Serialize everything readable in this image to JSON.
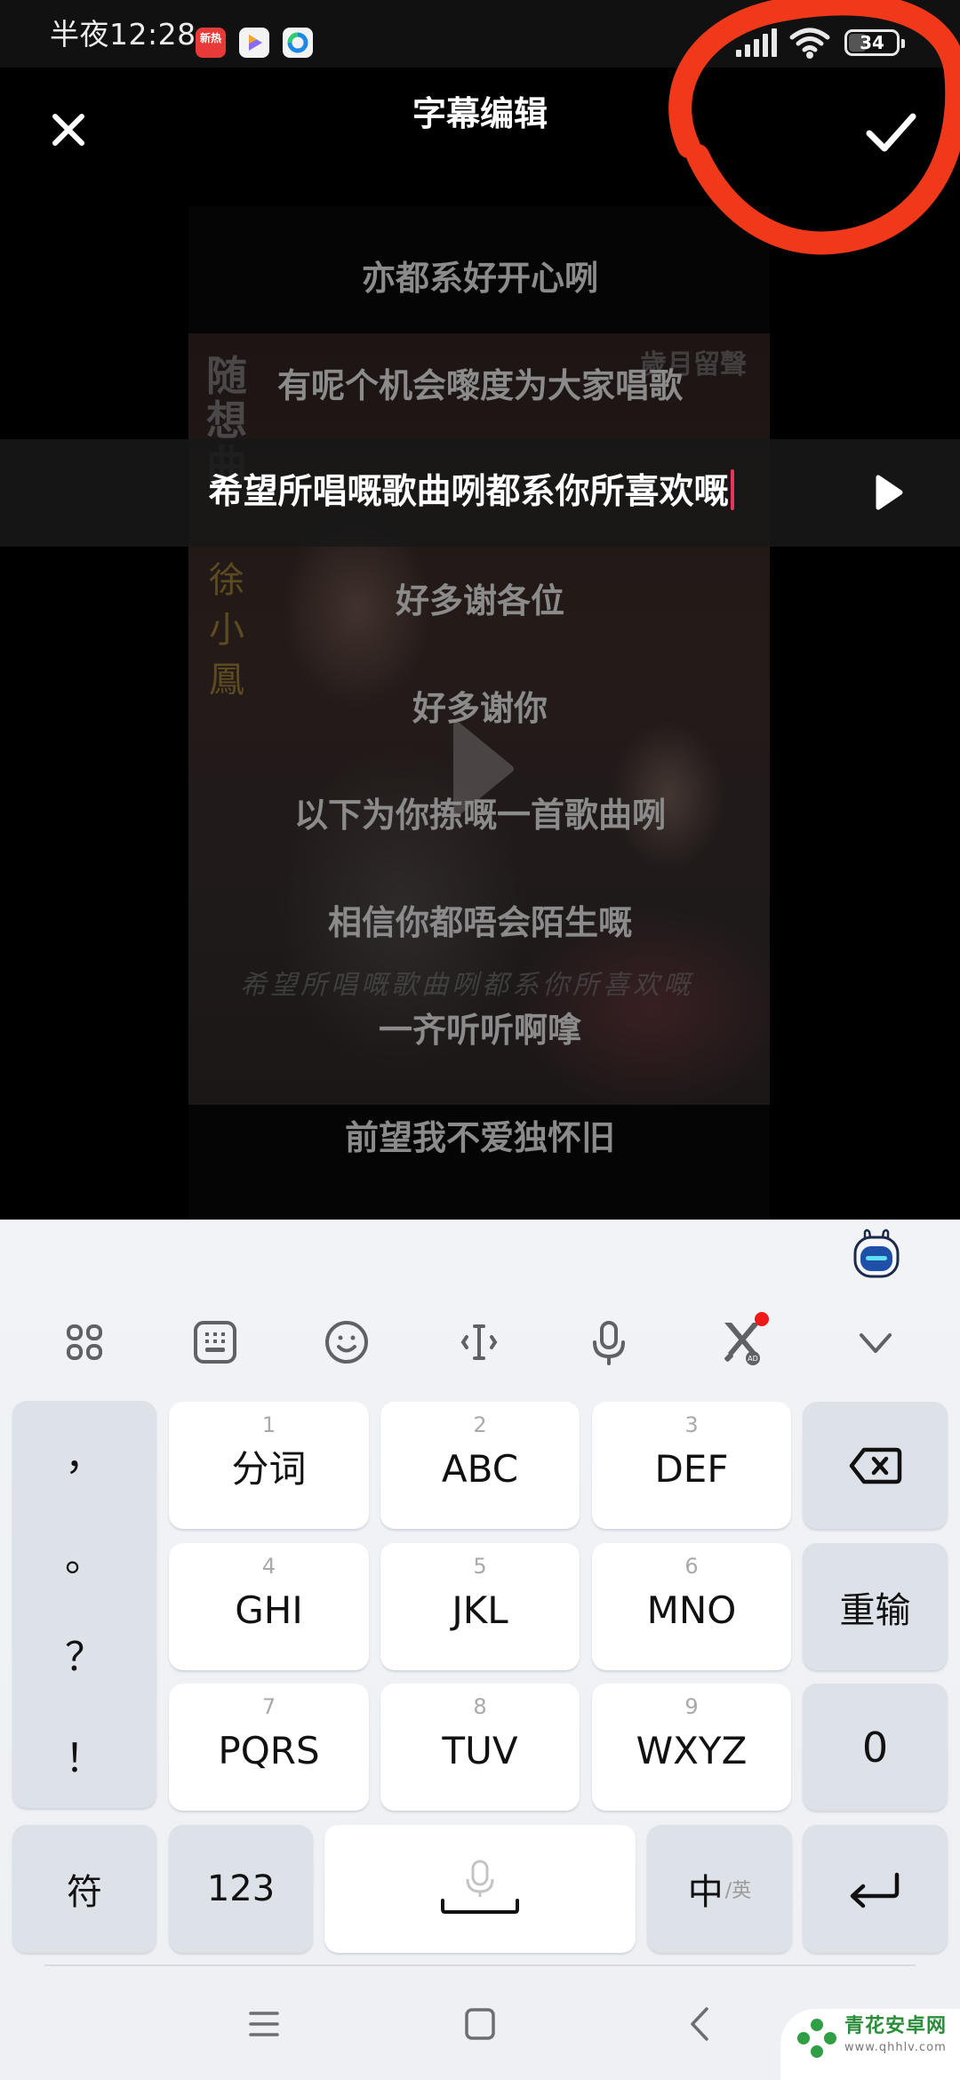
{
  "status_bar": {
    "time": "半夜12:28",
    "notification_apps": [
      {
        "name": "news-app",
        "label": "新热"
      },
      {
        "name": "video-app",
        "label": ""
      },
      {
        "name": "sync-app",
        "label": ""
      }
    ],
    "battery_level": "34"
  },
  "header": {
    "title": "字幕编辑",
    "close_icon": "close-icon",
    "confirm_icon": "check-icon"
  },
  "video": {
    "overlay_title": "随想曲",
    "overlay_artist": "徐小鳳",
    "overlay_brand": "歲月留聲",
    "overlay_script": "希望所唱嘅歌曲咧都系你所喜欢嘅"
  },
  "subtitles": [
    {
      "text": "亦都系好开心咧",
      "selected": false
    },
    {
      "text": "有呢个机会嚟度为大家唱歌",
      "selected": false
    },
    {
      "text": "希望所唱嘅歌曲咧都系你所喜欢嘅",
      "selected": true
    },
    {
      "text": "好多谢各位",
      "selected": false
    },
    {
      "text": "好多谢你",
      "selected": false
    },
    {
      "text": "以下为你拣嘅一首歌曲咧",
      "selected": false
    },
    {
      "text": "相信你都唔会陌生嘅",
      "selected": false
    },
    {
      "text": "一齐听听啊嗱",
      "selected": false
    },
    {
      "text": "前望我不爱独怀旧",
      "selected": false
    }
  ],
  "keyboard": {
    "toolbar": [
      "apps-grid-icon",
      "keyboard-icon",
      "emoji-icon",
      "cursor-move-icon",
      "microphone-icon",
      "game-ad-icon",
      "collapse-keyboard-icon"
    ],
    "punctuation": [
      "，",
      "。",
      "？",
      "！"
    ],
    "keys": [
      {
        "num": "1",
        "label": "分词"
      },
      {
        "num": "2",
        "label": "ABC"
      },
      {
        "num": "3",
        "label": "DEF"
      },
      {
        "num": "4",
        "label": "GHI"
      },
      {
        "num": "5",
        "label": "JKL"
      },
      {
        "num": "6",
        "label": "MNO"
      },
      {
        "num": "7",
        "label": "PQRS"
      },
      {
        "num": "8",
        "label": "TUV"
      },
      {
        "num": "9",
        "label": "WXYZ"
      }
    ],
    "reenter_label": "重输",
    "zero_label": "0",
    "symbols_label": "符",
    "numbers_label": "123",
    "lang_main": "中",
    "lang_sub": "/英"
  },
  "watermark": {
    "name": "青花安卓网",
    "url": "www.qhhlv.com"
  },
  "colors": {
    "cursor": "#e8335a",
    "annotation": "#f0391a",
    "subtitle_inactive": "#8b8b8b",
    "subtitle_active": "#ffffff"
  }
}
